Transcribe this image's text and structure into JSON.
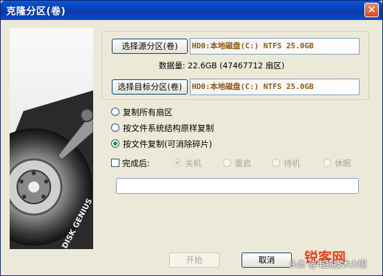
{
  "window": {
    "title": "克隆分区(卷)",
    "close_label": "✕"
  },
  "side_image": {
    "brand_text": "DISK GENIUS"
  },
  "source": {
    "button_label": "选择源分区(卷)",
    "value": "HD0:本地磁盘(C:) NTFS 25.0GB"
  },
  "data_size": {
    "text": "数据量: 22.6GB (47467712 扇区)"
  },
  "target": {
    "button_label": "选择目标分区(卷)",
    "value": "HD0:本地磁盘(C:) NTFS 25.0GB"
  },
  "copy_modes": [
    {
      "label": "复制所有扇区",
      "checked": false
    },
    {
      "label": "按文件系统结构原样复制",
      "checked": false
    },
    {
      "label": "按文件复制(可消除碎片)",
      "checked": true
    }
  ],
  "after_complete": {
    "label": "完成后:",
    "checked": false,
    "options": [
      {
        "label": "关机",
        "checked": true
      },
      {
        "label": "重启",
        "checked": false
      },
      {
        "label": "待机",
        "checked": false
      },
      {
        "label": "休眠",
        "checked": false
      }
    ]
  },
  "progress": {
    "fraction": 0.0
  },
  "buttons": {
    "start_label": "开始",
    "cancel_label": "取消"
  },
  "watermark": {
    "site": "锐客网",
    "credit": "头条 @电脑技术大明"
  },
  "colors": {
    "titlebar": "#0a4ad0",
    "disk_text": "#8b5a14",
    "radio_dot": "#21a121"
  }
}
